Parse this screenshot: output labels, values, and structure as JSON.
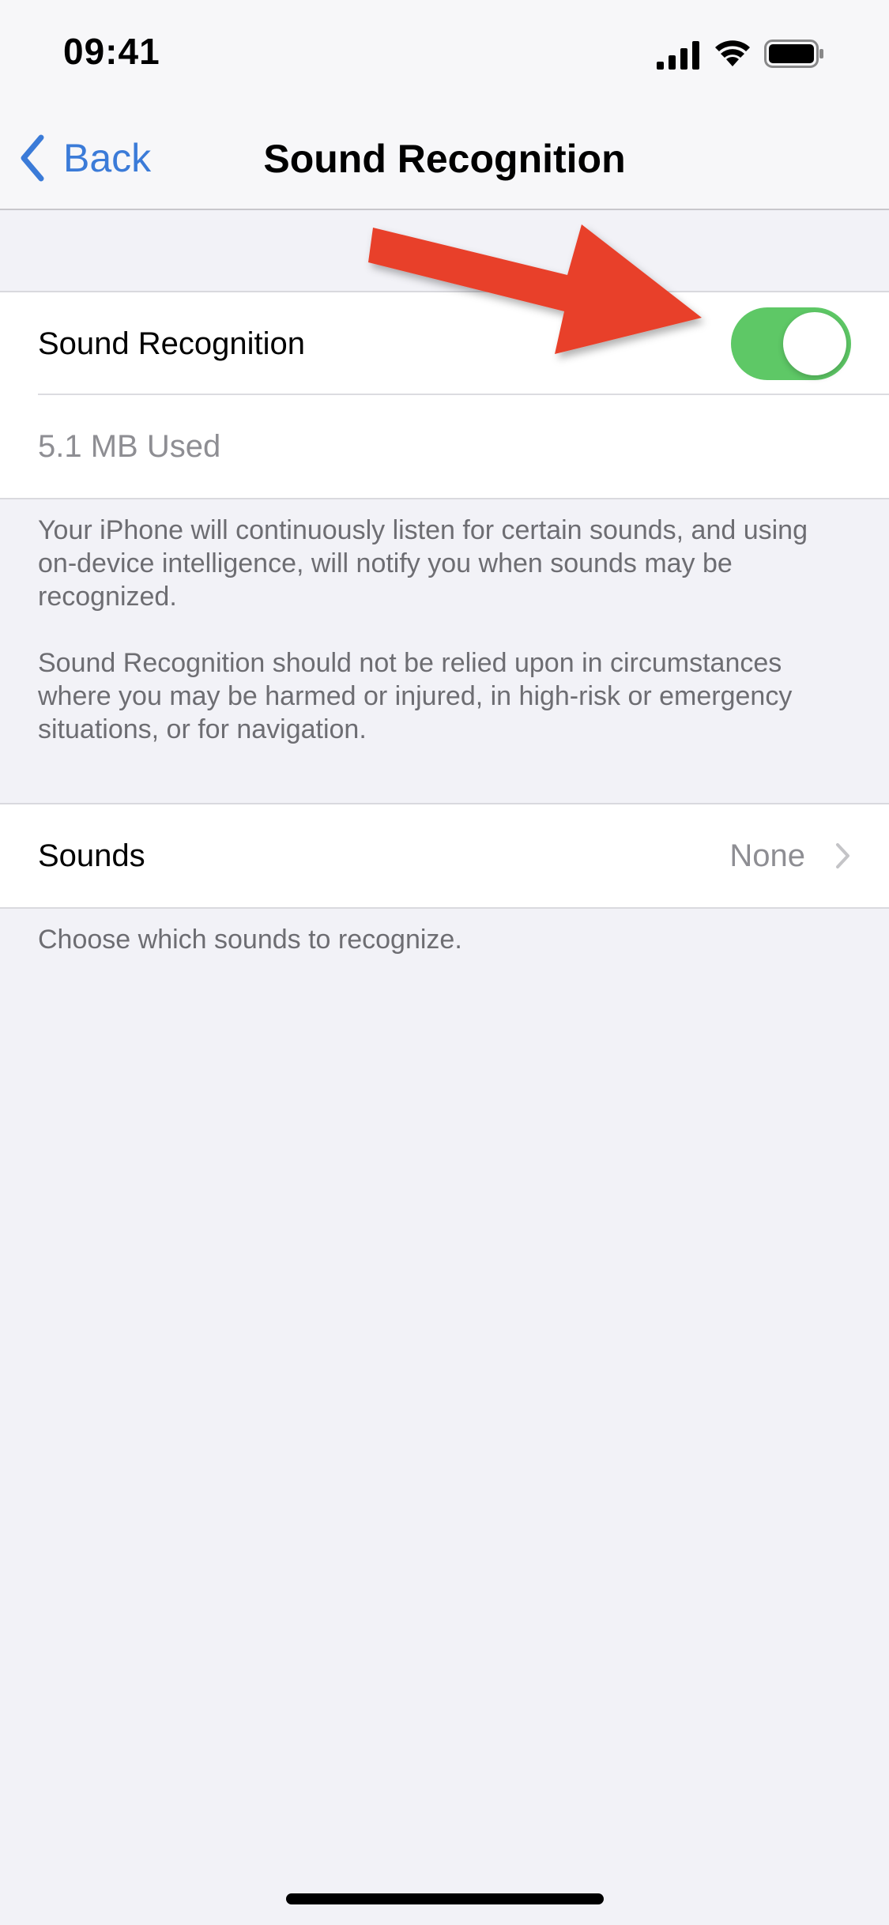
{
  "status_bar": {
    "time": "09:41",
    "icons": [
      "cellular-signal-icon",
      "wifi-icon",
      "battery-icon"
    ]
  },
  "nav": {
    "back_label": "Back",
    "title": "Sound Recognition",
    "accent_color": "#3b7bd8"
  },
  "main": {
    "sound_recognition": {
      "label": "Sound Recognition",
      "toggle_on": true,
      "toggle_color": "#5ec866"
    },
    "storage": {
      "label": "5.1 MB Used"
    },
    "description": [
      "Your iPhone will continuously listen for certain sounds, and using on-device intelligence, will notify you when sounds may be recognized.",
      "Sound Recognition should not be relied upon in circumstances where you may be harmed or injured, in high-risk or emergency situations, or for navigation."
    ],
    "sounds": {
      "label": "Sounds",
      "value": "None"
    },
    "sounds_footer": "Choose which sounds to recognize."
  },
  "annotation": {
    "arrow_color": "#e8402a"
  }
}
